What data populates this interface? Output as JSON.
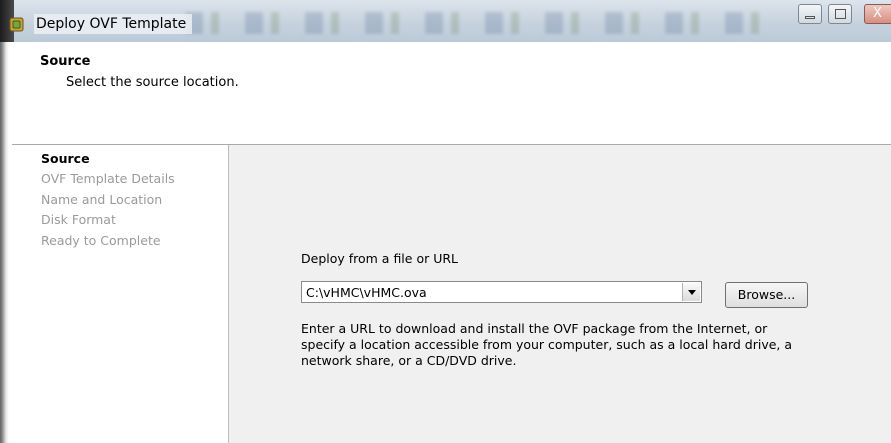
{
  "window": {
    "title": "Deploy OVF Template",
    "controls": {
      "minimize": "minimize",
      "maximize": "maximize",
      "close": "X"
    }
  },
  "header": {
    "title": "Source",
    "subtitle": "Select the source location."
  },
  "nav": {
    "items": [
      {
        "label": "Source",
        "active": true
      },
      {
        "label": "OVF Template Details",
        "active": false
      },
      {
        "label": "Name and Location",
        "active": false
      },
      {
        "label": "Disk Format",
        "active": false
      },
      {
        "label": "Ready to Complete",
        "active": false
      }
    ]
  },
  "content": {
    "deploy_label": "Deploy from a file or URL",
    "source_value": "C:\\vHMC\\vHMC.ova",
    "browse_label": "Browse...",
    "help_lines": [
      "Enter a URL to download and install the OVF package from the Internet, or",
      "specify a location accessible from your computer, such as a local hard drive, a",
      "network share, or a CD/DVD drive."
    ]
  },
  "colors": {
    "content_bg": "#f0f0f0",
    "nav_inactive": "#9a9a9a",
    "titlebar": "#c6d2de"
  },
  "icons": {
    "app": "vsphere-client-icon",
    "combo": "chevron-down-icon"
  }
}
